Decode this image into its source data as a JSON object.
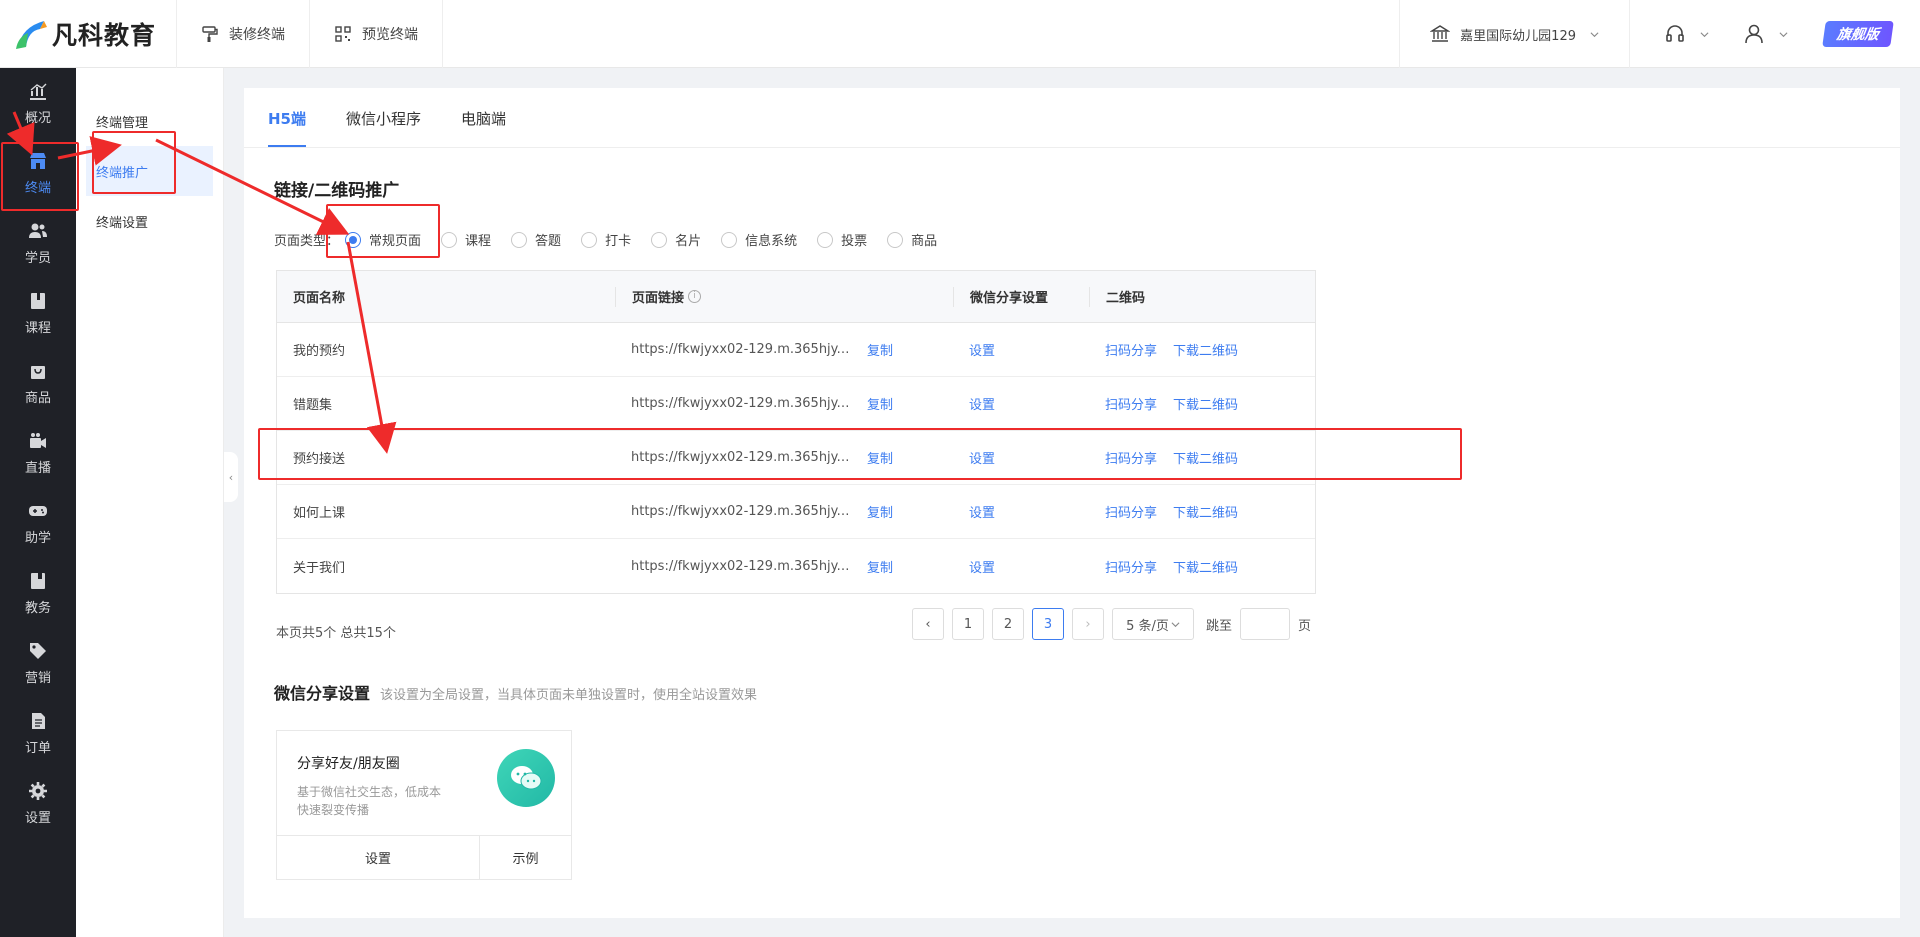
{
  "topbar": {
    "logo_text": "凡科教育",
    "tabs": [
      {
        "label": "装修终端"
      },
      {
        "label": "预览终端"
      }
    ],
    "school": "嘉里国际幼儿园129",
    "badge": "旗舰版"
  },
  "leftnav": {
    "items": [
      {
        "label": "概况"
      },
      {
        "label": "终端"
      },
      {
        "label": "学员"
      },
      {
        "label": "课程"
      },
      {
        "label": "商品"
      },
      {
        "label": "直播"
      },
      {
        "label": "助学"
      },
      {
        "label": "教务"
      },
      {
        "label": "营销"
      },
      {
        "label": "订单"
      },
      {
        "label": "设置"
      }
    ],
    "active": "终端"
  },
  "subnav": {
    "items": [
      {
        "label": "终端管理"
      },
      {
        "label": "终端推广"
      },
      {
        "label": "终端设置"
      }
    ],
    "active": "终端推广"
  },
  "tabs": [
    {
      "label": "H5端"
    },
    {
      "label": "微信小程序"
    },
    {
      "label": "电脑端"
    }
  ],
  "section_title": "链接/二维码推广",
  "page_type": {
    "label": "页面类型：",
    "options": [
      "常规页面",
      "课程",
      "答题",
      "打卡",
      "名片",
      "信息系统",
      "投票",
      "商品"
    ],
    "selected": "常规页面"
  },
  "table": {
    "headers": [
      "页面名称",
      "页面链接",
      "微信分享设置",
      "二维码"
    ],
    "copy_label": "复制",
    "set_label": "设置",
    "scan_label": "扫码分享",
    "download_label": "下载二维码",
    "rows": [
      {
        "name": "我的预约",
        "url": "https://fkwjyxx02-129.m.365hjy.co..."
      },
      {
        "name": "错题集",
        "url": "https://fkwjyxx02-129.m.365hjy.co..."
      },
      {
        "name": "预约接送",
        "url": "https://fkwjyxx02-129.m.365hjy.co..."
      },
      {
        "name": "如何上课",
        "url": "https://fkwjyxx02-129.m.365hjy.co..."
      },
      {
        "name": "关于我们",
        "url": "https://fkwjyxx02-129.m.365hjy.co..."
      }
    ]
  },
  "pagination": {
    "info": "本页共5个 总共15个",
    "pages": [
      "1",
      "2",
      "3"
    ],
    "current": "3",
    "page_size": "5 条/页",
    "jump_label": "跳至",
    "page_unit": "页"
  },
  "share": {
    "title": "微信分享设置",
    "desc": "该设置为全局设置，当具体页面未单独设置时，使用全站设置效果",
    "card_title": "分享好友/朋友圈",
    "card_desc": "基于微信社交生态，低成本快速裂变传播",
    "set_btn": "设置",
    "example_btn": "示例"
  },
  "colors": {
    "accent": "#3d7cf0",
    "annotation": "#ee2b2b",
    "nav_bg": "#1f2127"
  }
}
